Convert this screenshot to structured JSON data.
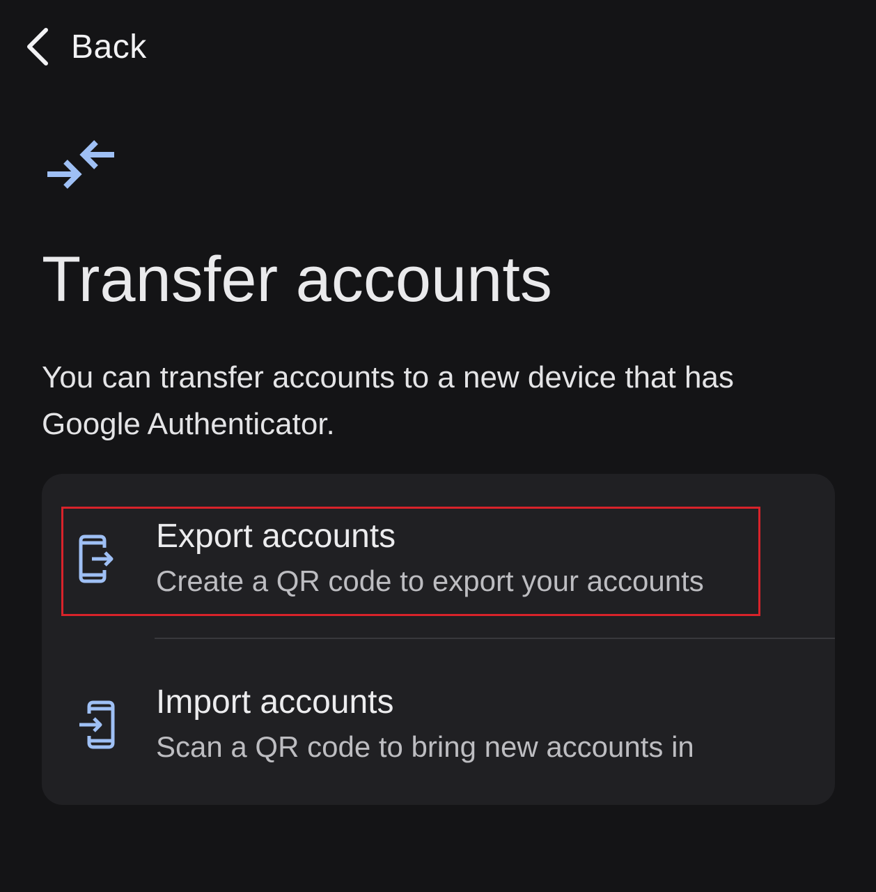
{
  "nav": {
    "back_label": "Back"
  },
  "header": {
    "icon": "transfer-arrows-icon",
    "title": "Transfer accounts"
  },
  "description": "You can transfer accounts to a new device that has Google Authenticator.",
  "options": [
    {
      "icon": "phone-export-icon",
      "title": "Export accounts",
      "subtitle": "Create a QR code to export your accounts"
    },
    {
      "icon": "phone-import-icon",
      "title": "Import accounts",
      "subtitle": "Scan a QR code to bring new accounts in"
    }
  ],
  "colors": {
    "background": "#141416",
    "card": "#202023",
    "accent_icon": "#9fc0f5",
    "highlight": "#d8232a"
  }
}
